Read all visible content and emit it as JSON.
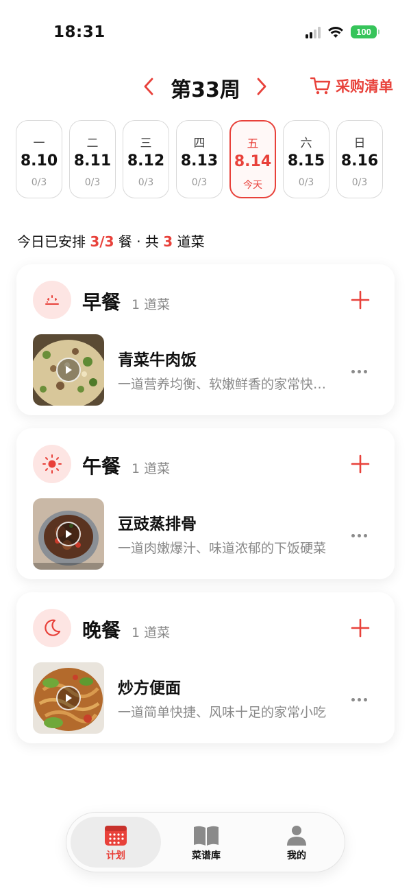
{
  "status_bar": {
    "time": "18:31",
    "battery": "100"
  },
  "header": {
    "week_title": "第33周",
    "shopping_list": "采购清单"
  },
  "days": [
    {
      "dow": "一",
      "date": "8.10",
      "count": "0/3",
      "active": false
    },
    {
      "dow": "二",
      "date": "8.11",
      "count": "0/3",
      "active": false
    },
    {
      "dow": "三",
      "date": "8.12",
      "count": "0/3",
      "active": false
    },
    {
      "dow": "四",
      "date": "8.13",
      "count": "0/3",
      "active": false
    },
    {
      "dow": "五",
      "date": "8.14",
      "count": "今天",
      "active": true
    },
    {
      "dow": "六",
      "date": "8.15",
      "count": "0/3",
      "active": false
    },
    {
      "dow": "日",
      "date": "8.16",
      "count": "0/3",
      "active": false
    }
  ],
  "summary": {
    "prefix": "今日已安排 ",
    "meals": "3/3",
    "middle": " 餐 · 共 ",
    "dishes": "3",
    "suffix": " 道菜"
  },
  "meals": [
    {
      "name": "早餐",
      "count": "1 道菜",
      "icon": "sunrise-icon",
      "dish": {
        "name": "青菜牛肉饭",
        "desc": "一道营养均衡、软嫩鲜香的家常快手饭"
      }
    },
    {
      "name": "午餐",
      "count": "1 道菜",
      "icon": "sun-icon",
      "dish": {
        "name": "豆豉蒸排骨",
        "desc": "一道肉嫩爆汁、味道浓郁的下饭硬菜"
      }
    },
    {
      "name": "晚餐",
      "count": "1 道菜",
      "icon": "moon-icon",
      "dish": {
        "name": "炒方便面",
        "desc": "一道简单快捷、风味十足的家常小吃"
      }
    }
  ],
  "tabs": [
    {
      "label": "计划",
      "icon": "calendar-icon",
      "active": true
    },
    {
      "label": "菜谱库",
      "icon": "book-icon",
      "active": false
    },
    {
      "label": "我的",
      "icon": "person-icon",
      "active": false
    }
  ],
  "colors": {
    "accent": "#e8413a",
    "accent_soft": "#fde5e3",
    "battery": "#36c45a"
  }
}
